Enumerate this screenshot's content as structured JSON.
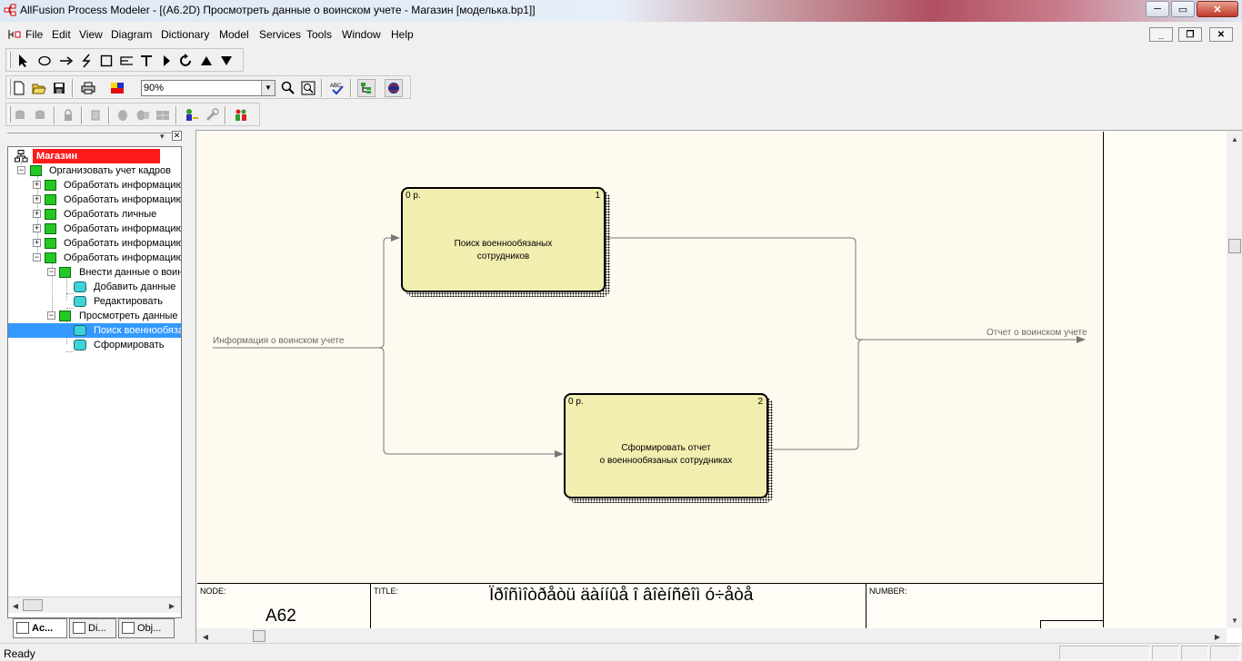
{
  "window": {
    "title": "AllFusion Process Modeler - [(A6.2D) Просмотреть данные о воинском учете - Магазин  [моделька.bp1]]",
    "minimize_label": "─",
    "maximize_label": "▭",
    "close_label": "✕"
  },
  "menu": {
    "items": [
      "File",
      "Edit",
      "View",
      "Diagram",
      "Dictionary",
      "Model",
      "Services",
      "Tools",
      "Window",
      "Help"
    ],
    "mdi_minimize": "_",
    "mdi_restore": "❐",
    "mdi_close": "✕"
  },
  "toolbar": {
    "zoom_value": "90%"
  },
  "tree": {
    "root": "Магазин",
    "items": [
      "Организовать учет кадров",
      "Обработать информацию",
      "Обработать информацию",
      "Обработать  личные",
      "Обработать информацию",
      "Обработать информацию",
      "Обработать информацию",
      "Внести данные о воинском",
      "Добавить данные",
      "Редактировать",
      "Просмотреть данные",
      "Поиск военнообязанных",
      "Сформировать"
    ]
  },
  "tabs": [
    "Ac...",
    "Di...",
    "Obj..."
  ],
  "diagram": {
    "box1": {
      "cost": "0 р.",
      "number": "1",
      "line1": "Поиск военнообязаных",
      "line2": "сотрудников"
    },
    "box2": {
      "cost": "0 р.",
      "number": "2",
      "line1": "Сформировать отчет",
      "line2": "о военнообязаных сотрудниках"
    },
    "input_label": "Информация о воинском учете",
    "output_label": "Отчет о воинском учете"
  },
  "footer": {
    "node_label": "NODE:",
    "node_value": "A62",
    "title_label": "TITLE:",
    "title_value": "Ïðîñìîòðåòü äàííûå î âîèíñêîì ó÷åòå",
    "number_label": "NUMBER:"
  },
  "status": {
    "text": "Ready"
  }
}
